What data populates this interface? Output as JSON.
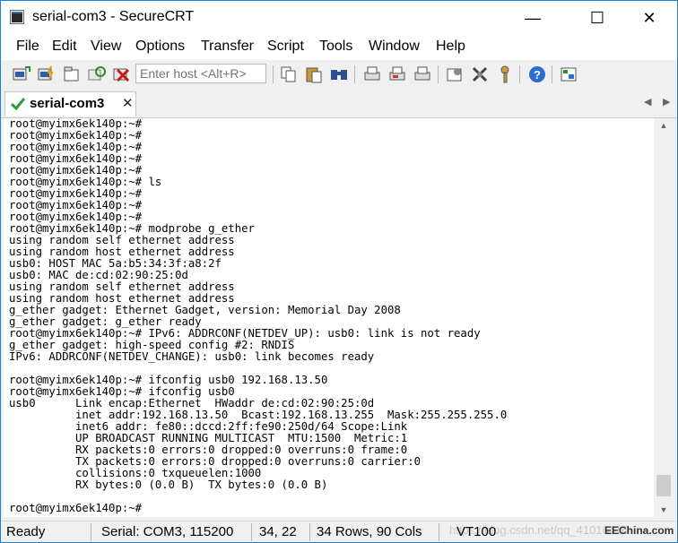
{
  "window": {
    "title": "serial-com3 - SecureCRT"
  },
  "menu": [
    "File",
    "Edit",
    "View",
    "Options",
    "Transfer",
    "Script",
    "Tools",
    "Window",
    "Help"
  ],
  "toolbar": {
    "host_placeholder": "Enter host <Alt+R>",
    "icons": [
      "connect-icon",
      "quick-connect-icon",
      "connect-in-tab-icon",
      "reconnect-icon",
      "disconnect-icon",
      "copy-icon",
      "paste-icon",
      "find-icon",
      "print-icon",
      "print-selection-icon",
      "print-setup-icon",
      "session-options-icon",
      "global-options-icon",
      "key-manager-icon",
      "help-icon",
      "map-icon"
    ]
  },
  "tab": {
    "label": "serial-com3",
    "close": "✕"
  },
  "terminal": {
    "lines": [
      "root@myimx6ek140p:~#",
      "root@myimx6ek140p:~#",
      "root@myimx6ek140p:~#",
      "root@myimx6ek140p:~#",
      "root@myimx6ek140p:~#",
      "root@myimx6ek140p:~# ls",
      "root@myimx6ek140p:~#",
      "root@myimx6ek140p:~#",
      "root@myimx6ek140p:~#",
      "root@myimx6ek140p:~# modprobe g_ether",
      "using random self ethernet address",
      "using random host ethernet address",
      "usb0: HOST MAC 5a:b5:34:3f:a8:2f",
      "usb0: MAC de:cd:02:90:25:0d",
      "using random self ethernet address",
      "using random host ethernet address",
      "g_ether gadget: Ethernet Gadget, version: Memorial Day 2008",
      "g_ether gadget: g_ether ready",
      "root@myimx6ek140p:~# IPv6: ADDRCONF(NETDEV_UP): usb0: link is not ready",
      "g_ether gadget: high-speed config #2: RNDIS",
      "IPv6: ADDRCONF(NETDEV_CHANGE): usb0: link becomes ready",
      "",
      "root@myimx6ek140p:~# ifconfig usb0 192.168.13.50",
      "root@myimx6ek140p:~# ifconfig usb0",
      "usb0      Link encap:Ethernet  HWaddr de:cd:02:90:25:0d",
      "          inet addr:192.168.13.50  Bcast:192.168.13.255  Mask:255.255.255.0",
      "          inet6 addr: fe80::dccd:2ff:fe90:250d/64 Scope:Link",
      "          UP BROADCAST RUNNING MULTICAST  MTU:1500  Metric:1",
      "          RX packets:0 errors:0 dropped:0 overruns:0 frame:0",
      "          TX packets:0 errors:0 dropped:0 overruns:0 carrier:0",
      "          collisions:0 txqueuelen:1000",
      "          RX bytes:0 (0.0 B)  TX bytes:0 (0.0 B)",
      "",
      "root@myimx6ek140p:~#"
    ]
  },
  "status": {
    "ready": "Ready",
    "connection": "Serial: COM3, 115200",
    "cursor": "34,  22",
    "size": "34 Rows, 90 Cols",
    "terminal_type": "VT100",
    "watermark": "https://blog.csdn.net/qq_41016416",
    "watermark_logo": "EEChina.com"
  }
}
